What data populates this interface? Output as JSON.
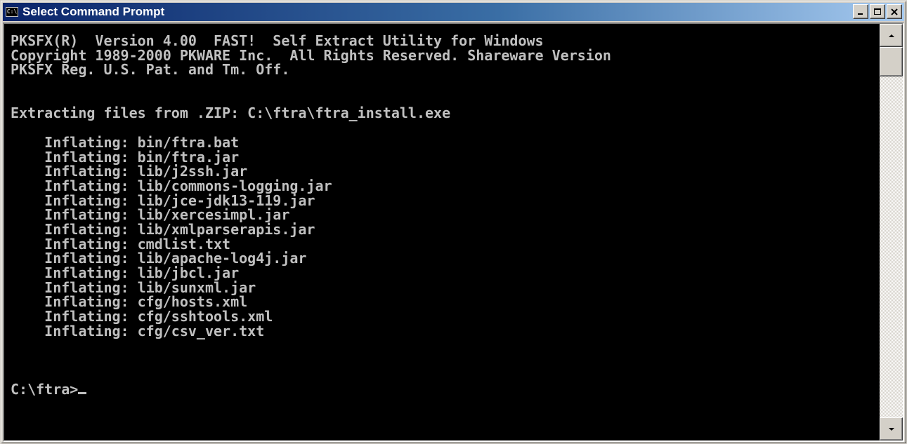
{
  "window": {
    "title": "Select Command Prompt",
    "icon": "console-icon",
    "icon_text": "C:\\",
    "controls": [
      "minimize-icon",
      "maximize-icon",
      "close-icon"
    ]
  },
  "console": {
    "text_color": "#c0c0c0",
    "background": "#000000",
    "lines": [
      "PKSFX(R)  Version 4.00  FAST!  Self Extract Utility for Windows",
      "Copyright 1989-2000 PKWARE Inc.  All Rights Reserved. Shareware Version",
      "PKSFX Reg. U.S. Pat. and Tm. Off.",
      "",
      "",
      "Extracting files from .ZIP: C:\\ftra\\ftra_install.exe",
      "",
      "    Inflating: bin/ftra.bat",
      "    Inflating: bin/ftra.jar",
      "    Inflating: lib/j2ssh.jar",
      "    Inflating: lib/commons-logging.jar",
      "    Inflating: lib/jce-jdk13-119.jar",
      "    Inflating: lib/xercesimpl.jar",
      "    Inflating: lib/xmlparserapis.jar",
      "    Inflating: cmdlist.txt",
      "    Inflating: lib/apache-log4j.jar",
      "    Inflating: lib/jbcl.jar",
      "    Inflating: lib/sunxml.jar",
      "    Inflating: cfg/hosts.xml",
      "    Inflating: cfg/sshtools.xml",
      "    Inflating: cfg/csv_ver.txt",
      "",
      "",
      ""
    ],
    "prompt": "C:\\ftra>"
  },
  "scrollbar": {
    "up_icon": "scroll-up-arrow-icon",
    "down_icon": "scroll-down-arrow-icon"
  }
}
